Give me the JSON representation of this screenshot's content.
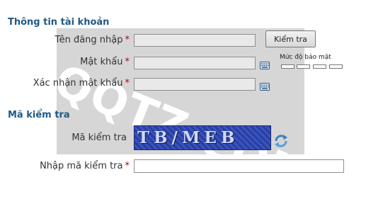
{
  "account_section": {
    "title": "Thông tin tài khoản",
    "username_label": "Tên đăng nhập",
    "username_value": "",
    "check_button_label": "Kiểm tra",
    "password_label": "Mật khẩu",
    "password_value": "",
    "confirm_label": "Xác nhận mật khẩu",
    "confirm_value": "",
    "required_mark": "*",
    "strength_label": "Mức độ bảo mật",
    "strength_level": 0,
    "strength_segments": 4,
    "keyboard_icon": "virtual-keyboard-icon"
  },
  "captcha_section": {
    "title": "Mã kiểm tra",
    "captcha_label": "Mã kiểm tra",
    "captcha_text": "TB/MEB",
    "refresh_icon": "refresh-icon",
    "input_label": "Nhập mã kiểm tra",
    "input_value": ""
  },
  "watermark": "QQTZ.COM",
  "colors": {
    "section_title": "#1f5a85",
    "required": "#c00000",
    "watermark_bg": "#d6d6d6"
  }
}
